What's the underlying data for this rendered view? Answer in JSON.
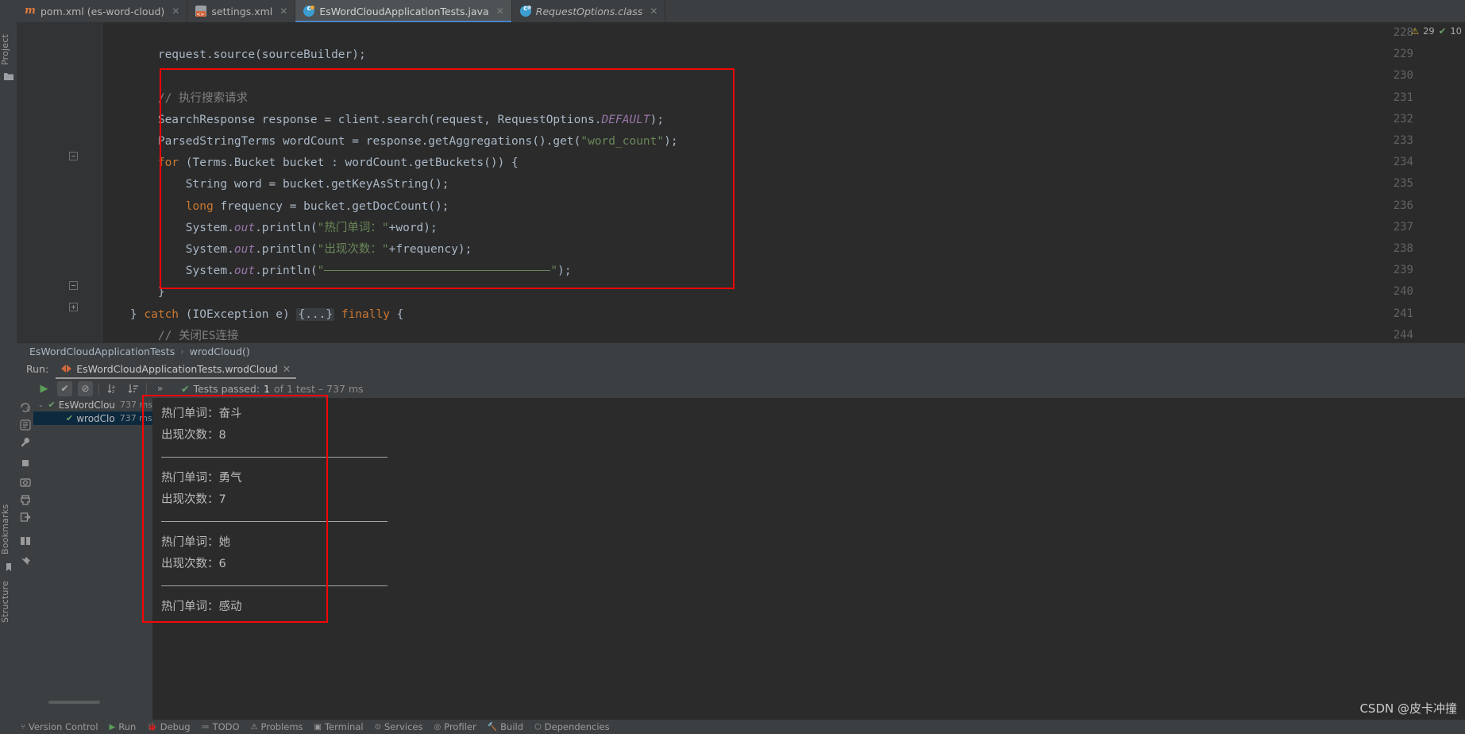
{
  "window": {
    "ide": "IntelliJ IDEA",
    "theme": "Darcula"
  },
  "left_strip": {
    "project_label": "Project",
    "bookmarks_label": "Bookmarks",
    "structure_label": "Structure"
  },
  "tabs": [
    {
      "label": "pom.xml (es-word-cloud)",
      "icon": "maven-icon",
      "active": false,
      "italic": false
    },
    {
      "label": "settings.xml",
      "icon": "xml-file-icon",
      "active": false,
      "italic": false
    },
    {
      "label": "EsWordCloudApplicationTests.java",
      "icon": "java-class-icon",
      "active": true,
      "italic": false
    },
    {
      "label": "RequestOptions.class",
      "icon": "compiled-class-icon",
      "active": false,
      "italic": true
    }
  ],
  "tab_close_glyph": "✕",
  "inspections": {
    "warning_count": "29",
    "warning_glyph": "⚠",
    "ok_glyph": "✔",
    "ok_count": "10"
  },
  "editor": {
    "line_numbers": [
      "228",
      "229",
      "230",
      "231",
      "232",
      "233",
      "234",
      "235",
      "236",
      "237",
      "238",
      "239",
      "240",
      "241",
      "244"
    ],
    "lines": [
      {
        "num": "228",
        "segments": []
      },
      {
        "num": "229",
        "segments": [
          {
            "t": "        request.source(sourceBuilder);",
            "c": ""
          }
        ]
      },
      {
        "num": "230",
        "segments": []
      },
      {
        "num": "231",
        "segments": [
          {
            "t": "        // 执行搜索请求",
            "c": "cmt"
          }
        ]
      },
      {
        "num": "232",
        "segments": [
          {
            "t": "        SearchResponse response = client.search(request, RequestOptions.",
            "c": ""
          },
          {
            "t": "DEFAULT",
            "c": "sf"
          },
          {
            "t": ");",
            "c": ""
          }
        ]
      },
      {
        "num": "233",
        "segments": [
          {
            "t": "        ParsedStringTerms wordCount = response.getAggregations().get(",
            "c": ""
          },
          {
            "t": "\"word_count\"",
            "c": "str"
          },
          {
            "t": ");",
            "c": ""
          }
        ]
      },
      {
        "num": "234",
        "segments": [
          {
            "t": "        for",
            "c": "k"
          },
          {
            "t": " (Terms.Bucket bucket : wordCount.getBuckets()) {",
            "c": ""
          }
        ]
      },
      {
        "num": "235",
        "segments": [
          {
            "t": "            String word = bucket.getKeyAsString();",
            "c": ""
          }
        ]
      },
      {
        "num": "236",
        "segments": [
          {
            "t": "            long",
            "c": "k"
          },
          {
            "t": " frequency = bucket.getDocCount();",
            "c": ""
          }
        ]
      },
      {
        "num": "237",
        "segments": [
          {
            "t": "            System.",
            "c": ""
          },
          {
            "t": "out",
            "c": "sf"
          },
          {
            "t": ".println(",
            "c": ""
          },
          {
            "t": "\"热门单词：\"",
            "c": "str"
          },
          {
            "t": "+word);",
            "c": ""
          }
        ]
      },
      {
        "num": "238",
        "segments": [
          {
            "t": "            System.",
            "c": ""
          },
          {
            "t": "out",
            "c": "sf"
          },
          {
            "t": ".println(",
            "c": ""
          },
          {
            "t": "\"出现次数：\"",
            "c": "str"
          },
          {
            "t": "+frequency);",
            "c": ""
          }
        ]
      },
      {
        "num": "239",
        "segments": [
          {
            "t": "            System.",
            "c": ""
          },
          {
            "t": "out",
            "c": "sf"
          },
          {
            "t": ".println(",
            "c": ""
          },
          {
            "t": "\"",
            "c": "str"
          },
          {
            "t": "RULE",
            "c": "rule"
          },
          {
            "t": "\"",
            "c": "str"
          },
          {
            "t": ");",
            "c": ""
          }
        ]
      },
      {
        "num": "240",
        "segments": [
          {
            "t": "        }",
            "c": ""
          }
        ]
      },
      {
        "num": "241",
        "segments": [
          {
            "t": "    } ",
            "c": ""
          },
          {
            "t": "catch",
            "c": "k"
          },
          {
            "t": " (IOException e) ",
            "c": ""
          },
          {
            "t": "{...}",
            "c": "fold"
          },
          {
            "t": " ",
            "c": ""
          },
          {
            "t": "finally",
            "c": "k"
          },
          {
            "t": " {",
            "c": ""
          }
        ]
      },
      {
        "num": "244",
        "segments": [
          {
            "t": "        // 关闭ES连接",
            "c": "cmt"
          }
        ]
      }
    ]
  },
  "breadcrumb": {
    "class": "EsWordCloudApplicationTests",
    "separator": "›",
    "method": "wrodCloud()"
  },
  "run_panel": {
    "run_label": "Run:",
    "config_name": "EsWordCloudApplicationTests.wrodCloud",
    "close_glyph": "✕",
    "toolbar": {
      "rerun": "▶",
      "toggle_passed": "✔",
      "mute": "⊘",
      "sort_alpha": "↓",
      "sort_duration": "↓",
      "expand": "»"
    },
    "status": {
      "check": "✔",
      "label": "Tests passed:",
      "count": "1",
      "suffix": "of 1 test – 737 ms"
    },
    "tree": [
      {
        "label": "EsWordClou",
        "time": "737 ms",
        "indent": 0,
        "selected": false,
        "chevron": "⌄",
        "check": "✔"
      },
      {
        "label": "wrodClo",
        "time": "737 ms",
        "indent": 1,
        "selected": true,
        "chevron": "",
        "check": "✔"
      }
    ],
    "left_icons": [
      "rerun-failed-icon",
      "rerun-icon",
      "wrench-icon",
      "stop-icon",
      "camera-icon",
      "print-icon",
      "export-icon",
      "layout-icon",
      "pin-icon"
    ]
  },
  "console": {
    "lines": [
      {
        "type": "text",
        "text": "热门单词：奋斗"
      },
      {
        "type": "text",
        "text": "出现次数：8"
      },
      {
        "type": "rule"
      },
      {
        "type": "text",
        "text": "热门单词：勇气"
      },
      {
        "type": "text",
        "text": "出现次数：7"
      },
      {
        "type": "rule"
      },
      {
        "type": "text",
        "text": "热门单词：她"
      },
      {
        "type": "text",
        "text": "出现次数：6"
      },
      {
        "type": "rule"
      },
      {
        "type": "text",
        "text": "热门单词：感动"
      }
    ]
  },
  "bottom_bar": [
    {
      "label": "Version Control",
      "glyph": "⑂"
    },
    {
      "label": "Run",
      "glyph": "▶"
    },
    {
      "label": "Debug",
      "glyph": "🐞"
    },
    {
      "label": "TODO",
      "glyph": "≔"
    },
    {
      "label": "Problems",
      "glyph": "⚠"
    },
    {
      "label": "Terminal",
      "glyph": "▣"
    },
    {
      "label": "Services",
      "glyph": "⊙"
    },
    {
      "label": "Profiler",
      "glyph": "◎"
    },
    {
      "label": "Build",
      "glyph": "🔨"
    },
    {
      "label": "Dependencies",
      "glyph": "⬡"
    }
  ],
  "watermark": "CSDN @皮卡冲撞",
  "colors": {
    "accent": "#4a88c7",
    "annotation": "#f90505",
    "string": "#6a8759",
    "keyword": "#cc7832",
    "editor_bg": "#2b2b2b",
    "ui_bg": "#3c3f41"
  }
}
